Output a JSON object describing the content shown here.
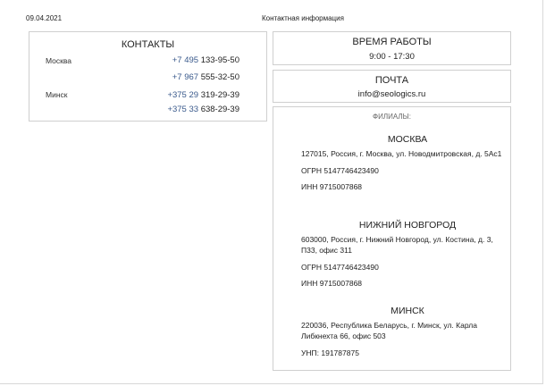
{
  "header": {
    "date": "09.04.2021",
    "title": "Контактная информация"
  },
  "contacts": {
    "title": "КОНТАКТЫ",
    "moscow": {
      "city": "Москва",
      "phones": [
        {
          "code": "+7 495",
          "number": "133-95-50"
        },
        {
          "code": "+7 967",
          "number": "555-32-50"
        }
      ]
    },
    "minsk": {
      "city": "Минск",
      "phones": [
        {
          "code": "+375 29",
          "number": "319-29-39"
        },
        {
          "code": "+375 33",
          "number": "638-29-39"
        }
      ]
    }
  },
  "hours": {
    "title": "ВРЕМЯ РАБОТЫ",
    "value": "9:00 - 17:30"
  },
  "mail": {
    "title": "ПОЧТА",
    "value": "info@seologics.ru"
  },
  "branches": {
    "title": "ФИЛИАЛЫ:",
    "items": [
      {
        "name": "МОСКВА",
        "address": "127015, Россия, г. Москва, ул. Новодмитровская, д. 5Ас1",
        "ogrn": "ОГРН 5147746423490",
        "inn": "ИНН 9715007868"
      },
      {
        "name": "НИЖНИЙ НОВГОРОД",
        "address": "603000, Россия, г. Нижний Новгород, ул. Костина, д. 3, П33, офис 311",
        "ogrn": "ОГРН 5147746423490",
        "inn": "ИНН 9715007868"
      },
      {
        "name": "МИНСК",
        "address": "220036, Республика Беларусь, г. Минск, ул. Карла Либкнехта 66, офис 503",
        "unp": "УНП: 191787875"
      }
    ]
  }
}
